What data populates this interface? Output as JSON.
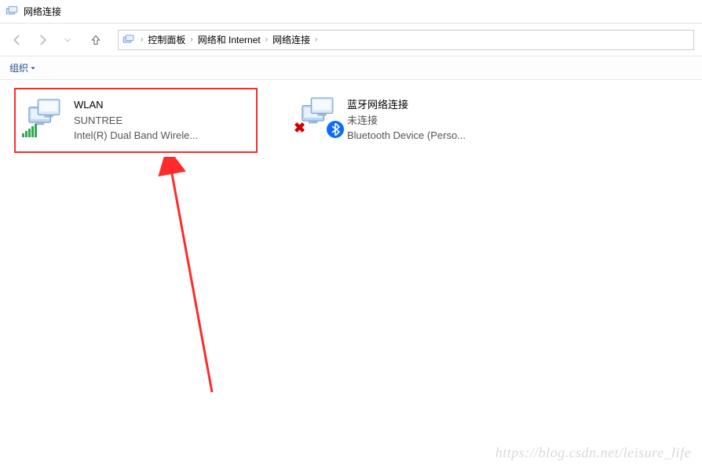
{
  "window": {
    "title": "网络连接"
  },
  "breadcrumbs": {
    "items": [
      {
        "label": "控制面板"
      },
      {
        "label": "网络和 Internet"
      },
      {
        "label": "网络连接"
      }
    ]
  },
  "toolbar": {
    "organize_label": "组织"
  },
  "connections": [
    {
      "name": "WLAN",
      "status": "SUNTREE",
      "device": "Intel(R) Dual Band Wirele...",
      "selected": true,
      "type": "wifi"
    },
    {
      "name": "蓝牙网络连接",
      "status": "未连接",
      "device": "Bluetooth Device (Perso...",
      "selected": false,
      "type": "bluetooth"
    }
  ],
  "watermark": "https://blog.csdn.net/leisure_life"
}
